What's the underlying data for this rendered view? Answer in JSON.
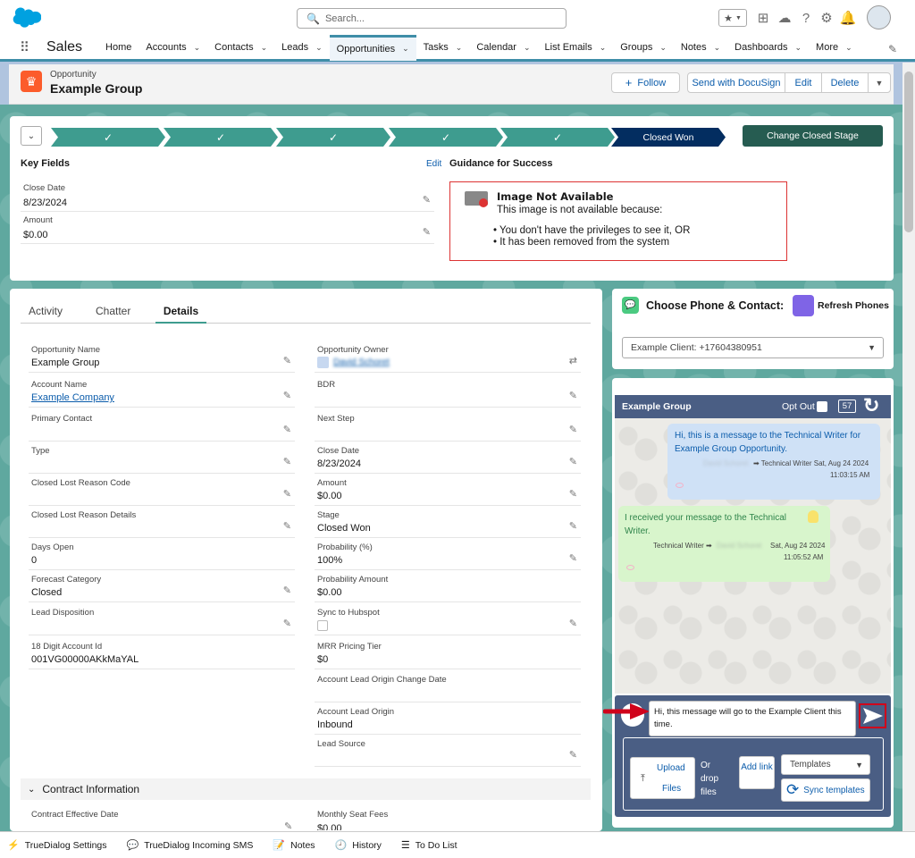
{
  "header": {
    "search_placeholder": "Search...",
    "app_name": "Sales"
  },
  "nav": [
    {
      "label": "Home",
      "chev": false
    },
    {
      "label": "Accounts",
      "chev": true
    },
    {
      "label": "Contacts",
      "chev": true
    },
    {
      "label": "Leads",
      "chev": true
    },
    {
      "label": "Opportunities",
      "chev": true,
      "active": true
    },
    {
      "label": "Tasks",
      "chev": true
    },
    {
      "label": "Calendar",
      "chev": true
    },
    {
      "label": "List Emails",
      "chev": true
    },
    {
      "label": "Groups",
      "chev": true
    },
    {
      "label": "Notes",
      "chev": true
    },
    {
      "label": "Dashboards",
      "chev": true
    },
    {
      "label": "More",
      "chev": true
    }
  ],
  "record": {
    "object_label": "Opportunity",
    "name": "Example Group",
    "follow": "Follow",
    "docusign": "Send with DocuSign",
    "edit": "Edit",
    "delete": "Delete"
  },
  "path": {
    "current_stage": "Closed Won",
    "change_btn": "Change Closed Stage",
    "check": "✓"
  },
  "key_fields": {
    "title": "Key Fields",
    "edit": "Edit",
    "close_date_label": "Close Date",
    "close_date": "8/23/2024",
    "amount_label": "Amount",
    "amount": "$0.00"
  },
  "guidance": {
    "title": "Guidance for Success",
    "img_title": "Image Not Available",
    "img_line1": "This image is not available because:",
    "img_bullet1": "• You don't have the privileges to see it, OR",
    "img_bullet2": "• It has been removed from the system"
  },
  "tabs": [
    "Activity",
    "Chatter",
    "Details"
  ],
  "details": {
    "left": [
      {
        "label": "Opportunity Name",
        "value": "Example Group"
      },
      {
        "label": "Account Name",
        "value": "Example Company",
        "link": true
      },
      {
        "label": "Primary Contact",
        "value": ""
      },
      {
        "label": "Type",
        "value": ""
      },
      {
        "label": "Closed Lost Reason Code",
        "value": ""
      },
      {
        "label": "Closed Lost Reason Details",
        "value": ""
      },
      {
        "label": "Days Open",
        "value": "0",
        "noedit": true
      },
      {
        "label": "Forecast Category",
        "value": "Closed"
      },
      {
        "label": "Lead Disposition",
        "value": ""
      },
      {
        "label": "18 Digit Account Id",
        "value": "001VG00000AKkMaYAL",
        "noedit": true
      }
    ],
    "right": [
      {
        "label": "Opportunity Owner",
        "value": "David Schoret",
        "link": true
      },
      {
        "label": "BDR",
        "value": ""
      },
      {
        "label": "Next Step",
        "value": ""
      },
      {
        "label": "Close Date",
        "value": "8/23/2024"
      },
      {
        "label": "Amount",
        "value": "$0.00"
      },
      {
        "label": "Stage",
        "value": "Closed Won"
      },
      {
        "label": "Probability (%)",
        "value": "100%"
      },
      {
        "label": "Probability Amount",
        "value": "$0.00",
        "noedit": true
      },
      {
        "label": "Sync to Hubspot",
        "value": "",
        "checkbox": true
      },
      {
        "label": "MRR Pricing Tier",
        "value": "$0",
        "noedit": true
      },
      {
        "label": "Account Lead Origin Change Date",
        "value": "",
        "noedit": true
      },
      {
        "label": "Account Lead Origin",
        "value": "Inbound",
        "noedit": true
      },
      {
        "label": "Lead Source",
        "value": ""
      }
    ],
    "section": "Contract Information",
    "bottom_left_label": "Contract Effective Date",
    "bottom_right_label": "Monthly Seat Fees",
    "bottom_right_value": "$0.00"
  },
  "phone": {
    "title": "Choose Phone & Contact:",
    "refresh": "Refresh Phones",
    "select_value": "Example Client: +17604380951"
  },
  "chat": {
    "title": "Example Group",
    "opt_out": "Opt Out",
    "count": "57",
    "msg1": "Hi, this is a message to the Technical Writer for Example Group Opportunity.",
    "msg1_meta_from": "David Schoret",
    "msg1_meta": "➡ Technical Writer Sat, Aug 24 2024",
    "msg1_time": "11:03:15 AM",
    "msg2": "I received your message to the Technical Writer.",
    "msg2_meta": "Technical Writer ➡",
    "msg2_meta_to": "David Schoret",
    "msg2_date": "Sat, Aug 24 2024",
    "msg2_time": "11:05:52 AM",
    "compose": "Hi, this message will go to the Example Client this time.",
    "upload": "Upload",
    "files": "Files",
    "or_drop": "Or drop files",
    "add_link": "Add link",
    "templates": "Templates",
    "sync": "Sync templates"
  },
  "utility": [
    {
      "icon": "⚡",
      "label": "TrueDialog Settings"
    },
    {
      "icon": "💬",
      "label": "TrueDialog Incoming SMS"
    },
    {
      "icon": "📝",
      "label": "Notes"
    },
    {
      "icon": "🕘",
      "label": "History"
    },
    {
      "icon": "☰",
      "label": "To Do List"
    }
  ],
  "colors": {
    "brand": "#0176d3",
    "teal": "#3e9c8f",
    "active_nav": "#3f8ea8",
    "chat_header": "#4a5e84"
  }
}
